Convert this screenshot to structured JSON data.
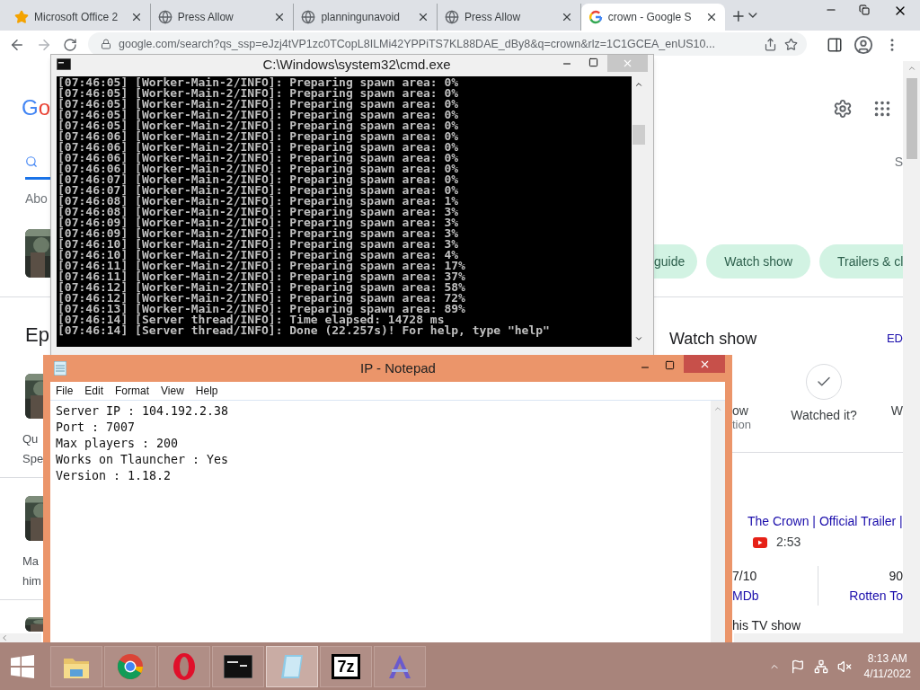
{
  "browser": {
    "tabs": [
      {
        "title": "Microsoft Office 2",
        "kind": "star",
        "selected": false
      },
      {
        "title": "Press Allow",
        "kind": "globe",
        "selected": false
      },
      {
        "title": "planningunavoid",
        "kind": "globe",
        "selected": false
      },
      {
        "title": "Press Allow",
        "kind": "globe",
        "selected": false
      },
      {
        "title": "crown - Google S",
        "kind": "google",
        "selected": true
      }
    ],
    "address": "google.com/search?qs_ssp=eJzj4tVP1zc0TCopL8ILMi42YPPiTS7KL88DAE_dBy8&q=crown&rlz=1C1GCEA_enUS10..."
  },
  "google": {
    "logo": "Go",
    "about_fragment": "Abo",
    "heading_fragment": "Ep",
    "result_fragments": [
      [
        "Qu",
        "Spe"
      ],
      [
        "Ma",
        "him"
      ]
    ],
    "side_letter": "S",
    "chips": [
      "guide",
      "Watch show",
      "Trailers & cl"
    ],
    "watch_heading": "Watch show",
    "edit_fragment": "ED",
    "actions": [
      {
        "kind": "partial",
        "lines": [
          "ow",
          "tion"
        ]
      },
      {
        "kind": "check",
        "label": "Watched it?"
      },
      {
        "kind": "partial",
        "lines": [
          "W"
        ]
      }
    ],
    "video": {
      "title": "The Crown | Official Trailer |",
      "duration": "2:53"
    },
    "ratings": [
      {
        "score": "7/10",
        "source": "MDb"
      },
      {
        "score": "90",
        "source": "Rotten To"
      }
    ],
    "footer_fragment": "his TV show"
  },
  "cmd": {
    "title": "C:\\Windows\\system32\\cmd.exe",
    "lines": [
      "[07:46:05] [Worker-Main-2/INFO]: Preparing spawn area: 0%",
      "[07:46:05] [Worker-Main-2/INFO]: Preparing spawn area: 0%",
      "[07:46:05] [Worker-Main-2/INFO]: Preparing spawn area: 0%",
      "[07:46:05] [Worker-Main-2/INFO]: Preparing spawn area: 0%",
      "[07:46:05] [Worker-Main-2/INFO]: Preparing spawn area: 0%",
      "[07:46:06] [Worker-Main-2/INFO]: Preparing spawn area: 0%",
      "[07:46:06] [Worker-Main-2/INFO]: Preparing spawn area: 0%",
      "[07:46:06] [Worker-Main-2/INFO]: Preparing spawn area: 0%",
      "[07:46:06] [Worker-Main-2/INFO]: Preparing spawn area: 0%",
      "[07:46:07] [Worker-Main-2/INFO]: Preparing spawn area: 0%",
      "[07:46:07] [Worker-Main-2/INFO]: Preparing spawn area: 0%",
      "[07:46:08] [Worker-Main-2/INFO]: Preparing spawn area: 1%",
      "[07:46:08] [Worker-Main-2/INFO]: Preparing spawn area: 3%",
      "[07:46:09] [Worker-Main-2/INFO]: Preparing spawn area: 3%",
      "[07:46:09] [Worker-Main-2/INFO]: Preparing spawn area: 3%",
      "[07:46:10] [Worker-Main-2/INFO]: Preparing spawn area: 3%",
      "[07:46:10] [Worker-Main-2/INFO]: Preparing spawn area: 4%",
      "[07:46:11] [Worker-Main-2/INFO]: Preparing spawn area: 17%",
      "[07:46:11] [Worker-Main-2/INFO]: Preparing spawn area: 37%",
      "[07:46:12] [Worker-Main-2/INFO]: Preparing spawn area: 58%",
      "[07:46:12] [Worker-Main-2/INFO]: Preparing spawn area: 72%",
      "[07:46:13] [Worker-Main-2/INFO]: Preparing spawn area: 89%",
      "[07:46:14] [Server thread/INFO]: Time elapsed: 14728 ms",
      "[07:46:14] [Server thread/INFO]: Done (22.257s)! For help, type \"help\""
    ]
  },
  "notepad": {
    "title": "IP - Notepad",
    "menu": [
      "File",
      "Edit",
      "Format",
      "View",
      "Help"
    ],
    "lines": [
      "Server IP : 104.192.2.38",
      "Port : 7007",
      "Max players : 200",
      "Works on Tlauncher : Yes",
      "Version : 1.18.2"
    ]
  },
  "taskbar": {
    "apps": [
      {
        "kind": "explorer",
        "active": false
      },
      {
        "kind": "chrome",
        "active": false
      },
      {
        "kind": "opera",
        "active": false
      },
      {
        "kind": "cmd",
        "active": false
      },
      {
        "kind": "notepad",
        "active": true
      },
      {
        "kind": "archiver",
        "label": "7z",
        "active": false
      },
      {
        "kind": "compass",
        "active": false
      }
    ],
    "time": "8:13 AM",
    "date": "4/11/2022"
  }
}
